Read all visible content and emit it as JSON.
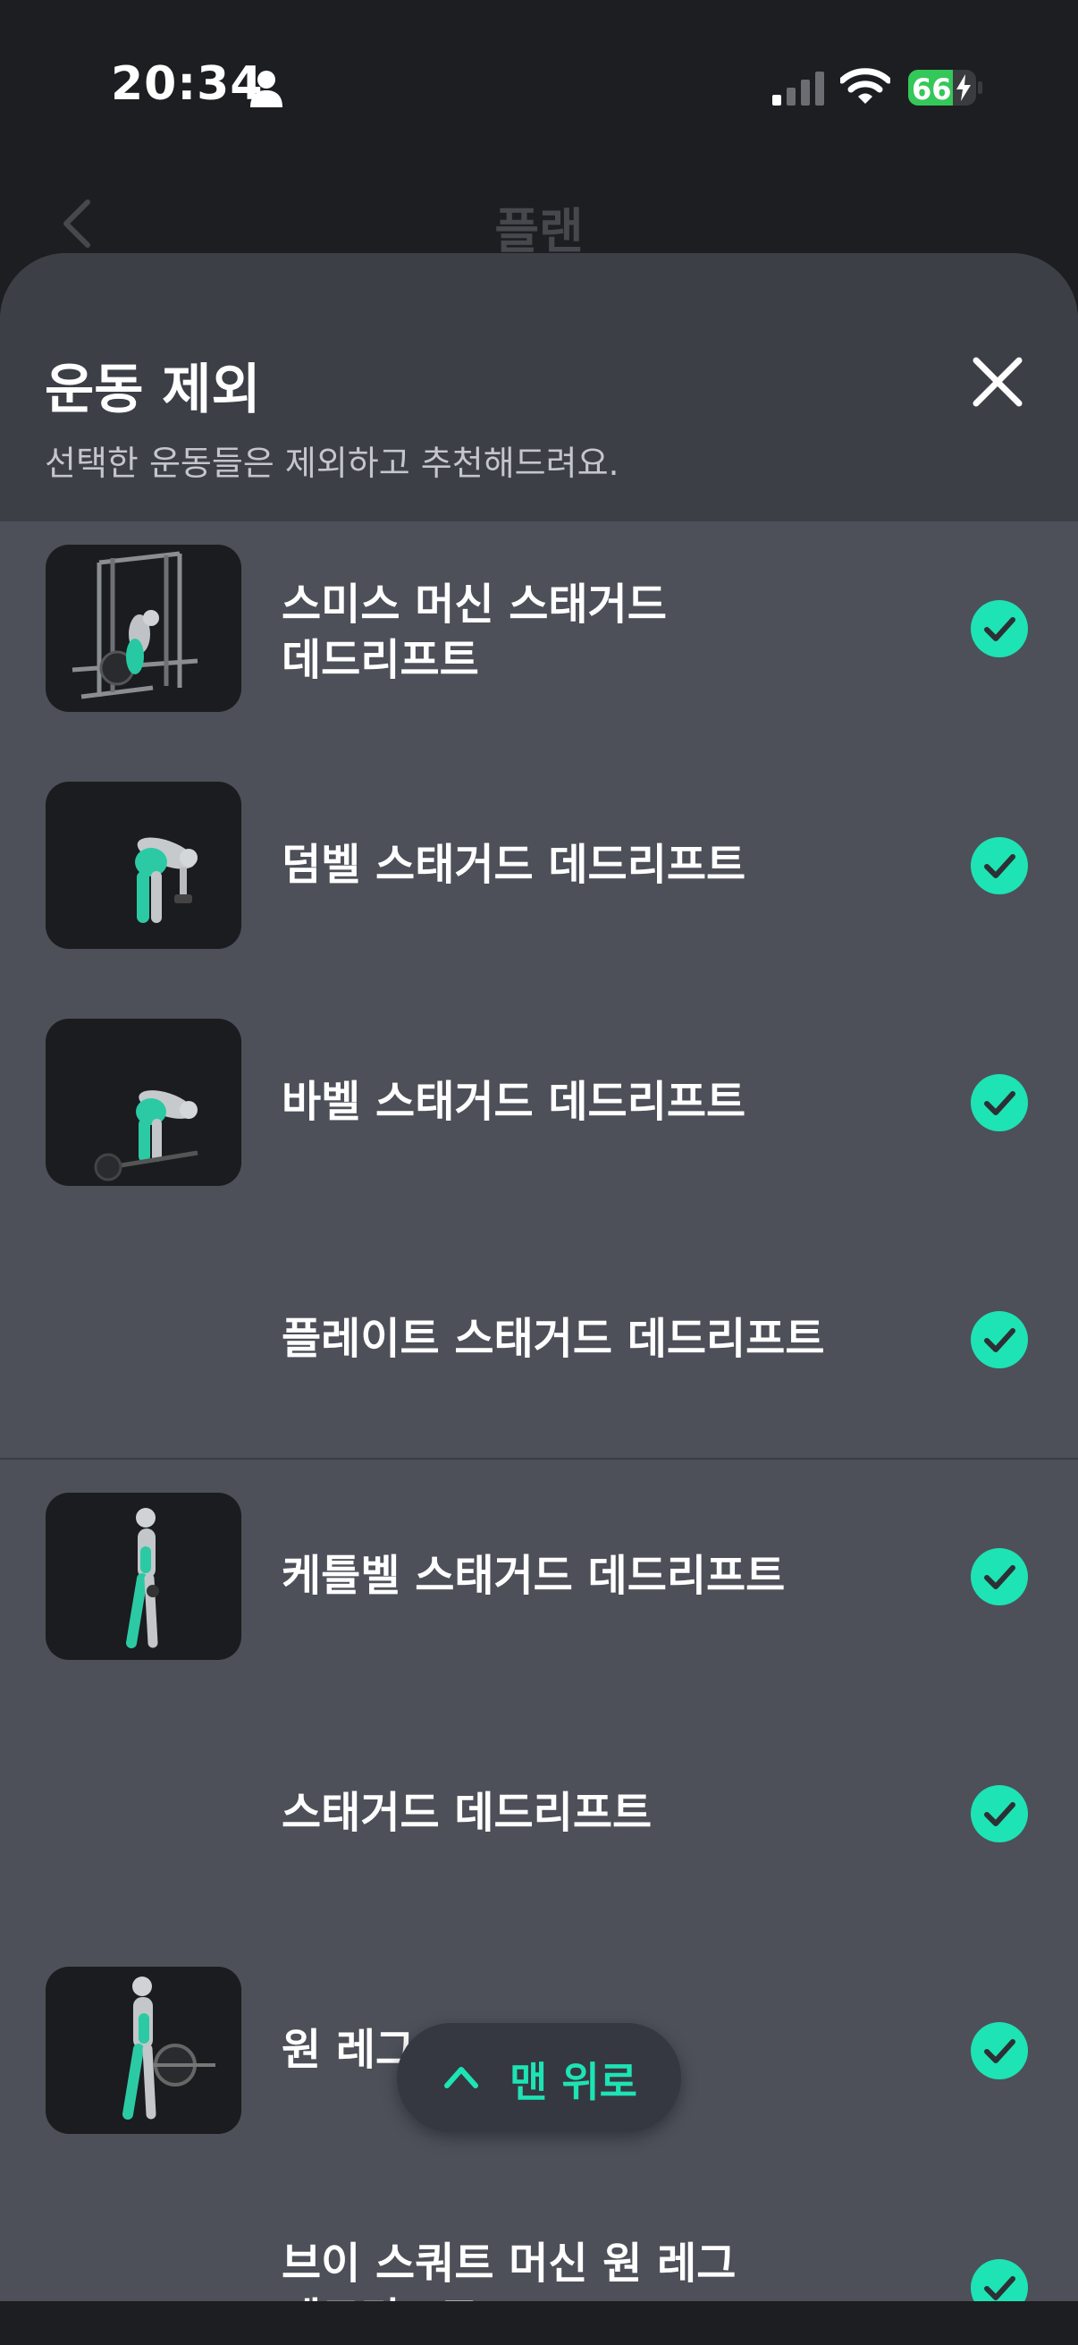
{
  "status_bar": {
    "time": "20:34",
    "battery_percent": 66,
    "battery_label": "66",
    "icons": [
      "person-icon",
      "signal-icon",
      "wifi-icon",
      "battery-charging-icon"
    ],
    "battery_color": "#34c759"
  },
  "nav": {
    "title": "플랜",
    "back_icon": "chevron-left-icon"
  },
  "sheet": {
    "title": "운동 제외",
    "subtitle": "선택한 운동들은 제외하고 추천해드려요.",
    "close_icon": "close-icon"
  },
  "exercises": [
    {
      "label": "스미스 머신 스태거드\n데드리프트",
      "has_image": true,
      "image": "smith-machine-figure",
      "checked": true
    },
    {
      "label": "덤벨 스태거드 데드리프트",
      "has_image": true,
      "image": "dumbbell-figure",
      "checked": true
    },
    {
      "label": "바벨 스태거드 데드리프트",
      "has_image": true,
      "image": "barbell-figure",
      "checked": true
    },
    {
      "label": "플레이트 스태거드 데드리프트",
      "has_image": false,
      "checked": true
    },
    {
      "label": "케틀벨 스태거드 데드리프트",
      "has_image": true,
      "image": "kettlebell-figure",
      "checked": true
    },
    {
      "label": "스태거드 데드리프트",
      "has_image": false,
      "checked": true
    },
    {
      "label": "원 레그 데드리프트",
      "has_image": true,
      "image": "one-leg-figure",
      "checked": true
    },
    {
      "label": "브이 스쿼트 머신 원 레그\n데드리프트",
      "has_image": false,
      "checked": true
    }
  ],
  "scroll_top": {
    "label": "맨 위로",
    "icon": "chevron-up-icon"
  },
  "colors": {
    "accent": "#1ee3b4",
    "sheet_bg": "#4d5059",
    "sheet_header_bg": "#3c3f46",
    "screen_bg": "#1d1e22"
  }
}
